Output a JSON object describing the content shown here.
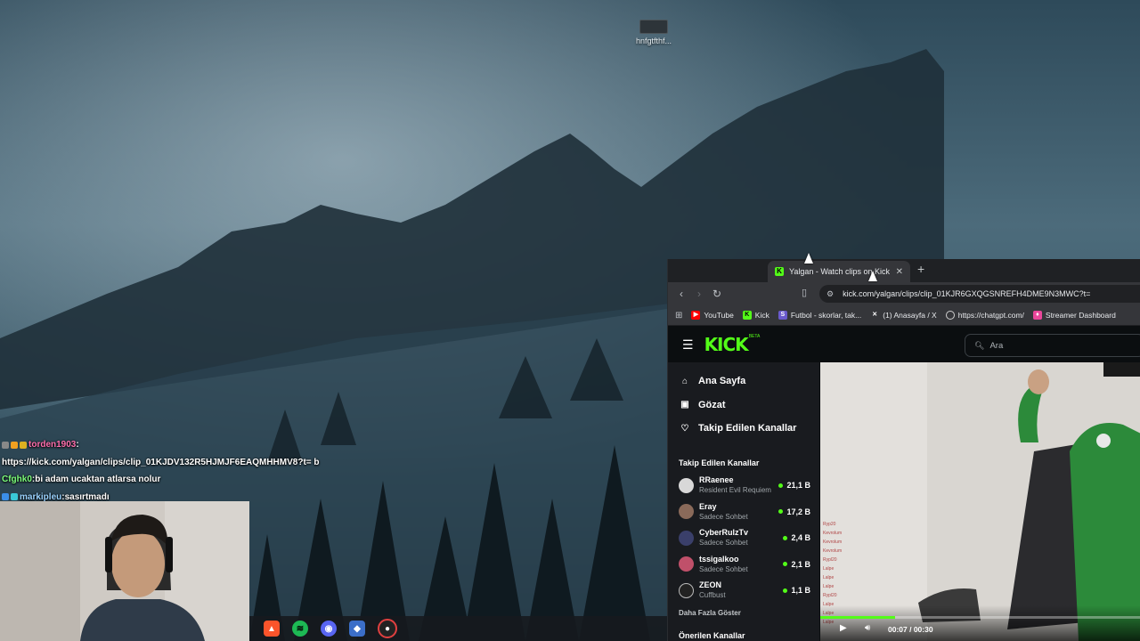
{
  "desktop": {
    "icon_label": "hnfgtfthf..."
  },
  "chat": {
    "messages": [
      {
        "user": "torden1903",
        "sep": " :",
        "text": ""
      },
      {
        "user": "",
        "sep": "",
        "text": "https://kick.com/yalgan/clips/clip_01KJDV132R5HJMJF6EAQMHHMV8?t= b"
      },
      {
        "user": "Cfghk0",
        "sep": " : ",
        "text": "bi adam ucaktan atlarsa nolur"
      },
      {
        "user": "markipleu",
        "sep": " : ",
        "text": "sasırtmadı"
      }
    ]
  },
  "browser": {
    "tab_title": "Yalgan - Watch clips on Kick",
    "tab_favicon": "K",
    "tab_close": "✕",
    "new_tab": "+",
    "url": "kick.com/yalgan/clips/clip_01KJR6GXQGSNREFH4DME9N3MWC?t=",
    "bookmarks": [
      {
        "label": "YouTube",
        "icon": "youtube-icon",
        "color": "#ff0000"
      },
      {
        "label": "Kick",
        "icon": "kick-icon",
        "color": "#53fc18"
      },
      {
        "label": "Futbol - skorlar, tak...",
        "icon": "flashscore-icon",
        "color": "#6a5acd"
      },
      {
        "label": "(1) Anasayfa / X",
        "icon": "x-icon",
        "color": "#ffffff"
      },
      {
        "label": "https://chatgpt.com/",
        "icon": "chatgpt-icon",
        "color": "#d0d0d0"
      },
      {
        "label": "Streamer Dashboard",
        "icon": "twitch-dashboard-icon",
        "color": "#e9469a"
      }
    ]
  },
  "kick": {
    "logo": "KICK",
    "logo_badge": "BETA",
    "search_placeholder": "Ara",
    "nav": [
      {
        "label": "Ana Sayfa",
        "icon": "home-icon"
      },
      {
        "label": "Gözat",
        "icon": "browse-icon"
      },
      {
        "label": "Takip Edilen Kanallar",
        "icon": "heart-icon"
      }
    ],
    "followed_title": "Takip Edilen Kanallar",
    "channels": [
      {
        "name": "RRaenee",
        "category": "Resident Evil Requiem",
        "viewers": "21,1 B",
        "avatar_color": "#d8d8d8"
      },
      {
        "name": "Eray",
        "category": "Sadece Sohbet",
        "viewers": "17,2 B",
        "avatar_color": "#8a6a5a"
      },
      {
        "name": "CyberRulzTv",
        "category": "Sadece Sohbet",
        "viewers": "2,4 B",
        "avatar_color": "#3a3f6a"
      },
      {
        "name": "tssigalkoo",
        "category": "Sadece Sohbet",
        "viewers": "2,1 B",
        "avatar_color": "#c0506a"
      },
      {
        "name": "ZEON",
        "category": "Cuffbust",
        "viewers": "1,1 B",
        "avatar_color": "#222222"
      }
    ],
    "show_more": "Daha Fazla Göster",
    "recommended_title": "Önerilen Kanallar"
  },
  "player": {
    "current_time": "00:07",
    "duration": "00:30",
    "time_display": "00:07 / 00:30",
    "progress_fraction": 0.233,
    "accent": "#53fc18"
  }
}
